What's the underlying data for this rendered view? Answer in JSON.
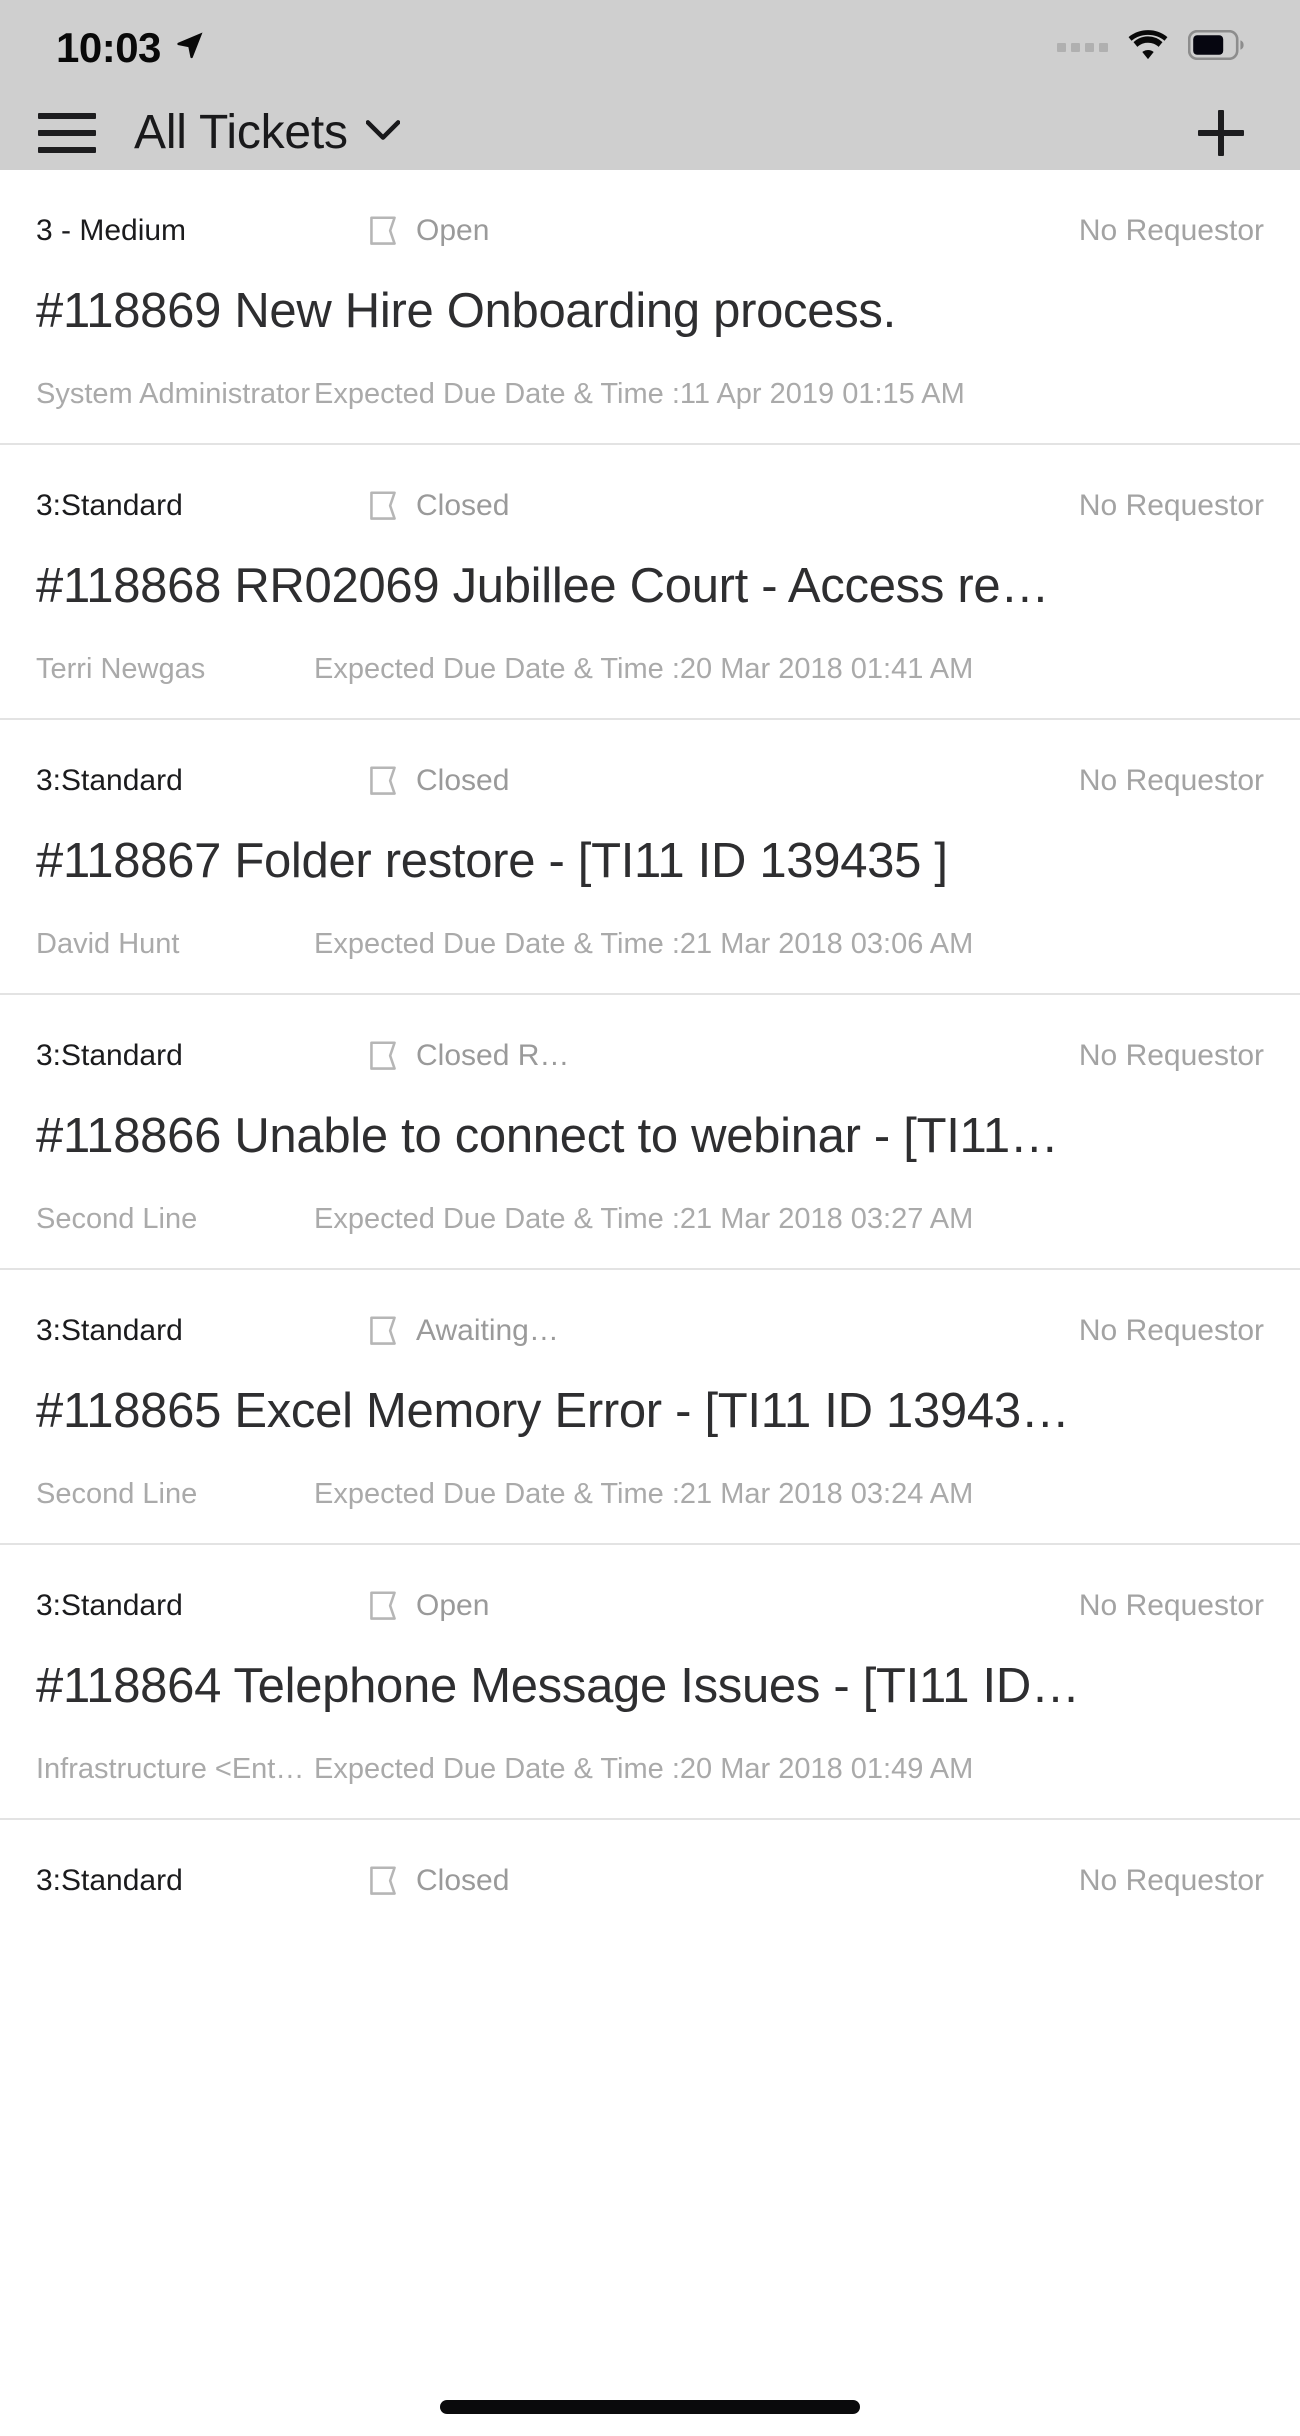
{
  "status_bar": {
    "time": "10:03",
    "location_icon": "location-arrow-icon",
    "signal_icon": "signal-dots-icon",
    "wifi_icon": "wifi-icon",
    "battery_icon": "battery-icon"
  },
  "header": {
    "menu_icon": "hamburger-menu-icon",
    "title": "All Tickets",
    "chevron_icon": "chevron-down-icon",
    "add_icon": "plus-icon"
  },
  "labels": {
    "due_prefix": "Expected Due Date & Time :",
    "status_icon": "flag-icon"
  },
  "colors": {
    "header_bg": "#cfcfcf",
    "list_bg": "#ffffff",
    "title_text": "#2e2e30",
    "muted_text": "#a3a3a3",
    "divider": "#e3e3e3"
  },
  "tickets": [
    {
      "priority": "3 - Medium",
      "status": "Open",
      "requestor": "No Requestor",
      "title": "#118869 New Hire Onboarding process.",
      "assignee": "System Administrator",
      "due": "Expected Due Date & Time :11 Apr 2019 01:15 AM"
    },
    {
      "priority": "3:Standard",
      "status": "Closed",
      "requestor": "No Requestor",
      "title": "#118868 RR02069 Jubillee Court - Access re…",
      "assignee": "Terri Newgas",
      "due": "Expected Due Date & Time :20 Mar 2018 01:41 AM"
    },
    {
      "priority": "3:Standard",
      "status": "Closed",
      "requestor": "No Requestor",
      "title": "#118867 Folder restore - [TI11 ID 139435 ]",
      "assignee": "David Hunt",
      "due": "Expected Due Date & Time :21 Mar 2018 03:06 AM"
    },
    {
      "priority": "3:Standard",
      "status": "Closed R…",
      "requestor": "No Requestor",
      "title": "#118866 Unable to connect to webinar - [TI11…",
      "assignee": "Second Line",
      "due": "Expected Due Date & Time :21 Mar 2018 03:27 AM"
    },
    {
      "priority": "3:Standard",
      "status": "Awaiting…",
      "requestor": "No Requestor",
      "title": "#118865 Excel Memory Error - [TI11 ID 13943…",
      "assignee": "Second Line",
      "due": "Expected Due Date & Time :21 Mar 2018 03:24 AM"
    },
    {
      "priority": "3:Standard",
      "status": "Open",
      "requestor": "No Requestor",
      "title": "#118864 Telephone Message Issues - [TI11 ID…",
      "assignee": "Infrastructure <Enter L…",
      "due": "Expected Due Date & Time :20 Mar 2018 01:49 AM"
    },
    {
      "priority": "3:Standard",
      "status": "Closed",
      "requestor": "No Requestor",
      "title": "",
      "assignee": "",
      "due": ""
    }
  ]
}
